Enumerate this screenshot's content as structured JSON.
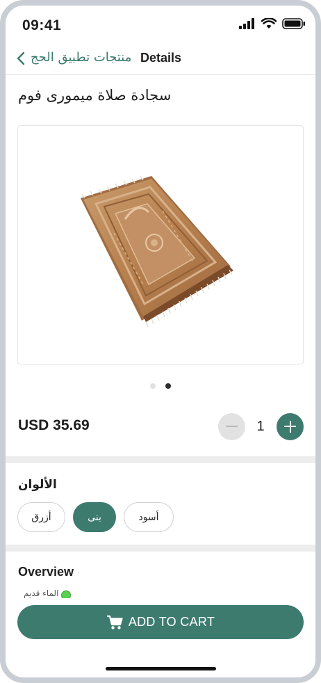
{
  "status_bar": {
    "time": "09:41"
  },
  "nav": {
    "back_label": "منتجات تطبيق الحج",
    "title": "Details"
  },
  "product": {
    "title": "سجادة صلاة ميمورى فوم",
    "image_alt": "prayer-rug-photo",
    "gallery": {
      "count": 2,
      "active_index": 1
    },
    "price": "USD 35.69",
    "quantity": "1"
  },
  "colors": {
    "label": "الألوان",
    "options": [
      {
        "label": "أسود",
        "selected": false
      },
      {
        "label": "بنى",
        "selected": true
      },
      {
        "label": "أزرق",
        "selected": false
      }
    ]
  },
  "overview": {
    "label": "Overview",
    "peek_text": "الماء قديم"
  },
  "cart_button": {
    "label": "ADD TO CART",
    "icon": "cart-icon"
  },
  "theme": {
    "accent": "#3d7b6f",
    "divider": "#ededed"
  }
}
